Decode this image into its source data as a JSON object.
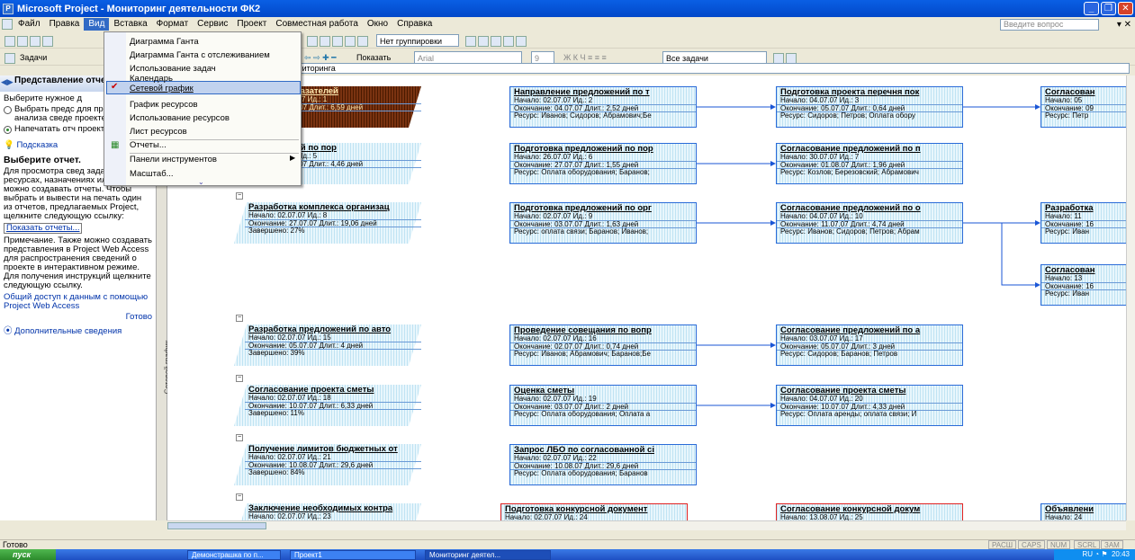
{
  "window": {
    "title": "Microsoft Project - Мониторинг деятельности ФК2"
  },
  "menubar": {
    "items": [
      "Файл",
      "Правка",
      "Вид",
      "Вставка",
      "Формат",
      "Сервис",
      "Проект",
      "Совместная работа",
      "Окно",
      "Справка"
    ],
    "ask_placeholder": "Введите вопрос"
  },
  "toolbar": {
    "grouping": "Нет группировки",
    "show_label": "Показать",
    "font": "Arial",
    "font_size": "9",
    "filter": "Все задачи",
    "tasks_label": "Задачи"
  },
  "entry_bar": {
    "value": "й для мониторинга"
  },
  "view_menu": {
    "items": [
      "Диаграмма Ганта",
      "Диаграмма Ганта с отслеживанием",
      "Использование задач",
      "Календарь",
      "Сетевой график",
      "График ресурсов",
      "Использование ресурсов",
      "Лист ресурсов",
      "Отчеты...",
      "Панели инструментов",
      "Масштаб..."
    ],
    "checked_index": 4
  },
  "side_pane": {
    "title": "Представление отчеты",
    "intro": "Выберите нужное д",
    "option1": "Выбрать предс для просмотра анализа сведе проекте",
    "option2": "Напечатать отч проекте",
    "hint_label": "Подсказка",
    "section_title": "Выберите отчет.",
    "body1": "Для просмотра свед задачах, ресурсах, назначениях или затратах можно создавать отчеты. Чтобы выбрать и вывести на печать один из отчетов, предлагаемых Project, щелкните следующую ссылку:",
    "show_reports_link": "Показать отчеты...",
    "body2": "Примечание. Также можно создавать представления в Project Web Access для распространения сведений о проекте в интерактивном режиме. Для получения инструкций щелкните следующую ссылку.",
    "share_link": "Общий доступ к данным с помощью Project Web Access",
    "done": "Готово",
    "more_info": "Дополнительные сведения"
  },
  "view_bar_label": "Сетевой график",
  "network": {
    "labels": {
      "start": "Начало:",
      "end": "Окончание:",
      "id": "Ид.:",
      "dur": "Длит.:",
      "done": "Завершено:",
      "res": "Ресурс:"
    },
    "nodes": [
      {
        "title": "перечня показателей",
        "start": "02.07.07",
        "id": "1",
        "end": "07.07",
        "dur": "6,59 дней",
        "row3": "",
        "summary": true,
        "dark": true
      },
      {
        "title": "Направление предложений по т",
        "start": "02.07.07",
        "id": "2",
        "end": "04.07.07",
        "dur": "2,52 дней",
        "row3": "Иванов; Сидоров; Абрамович;Бе"
      },
      {
        "title": "Подготовка проекта перечня пок",
        "start": "04.07.07",
        "id": "3",
        "end": "05.07.07",
        "dur": "0,64 дней",
        "row3": "Сидоров; Петров; Оплата обору"
      },
      {
        "title": "Согласован",
        "start": "05",
        "id": "",
        "end": "09",
        "dur": "",
        "row3": "Петр"
      },
      {
        "title": "предложений по пор",
        "start": "07.07",
        "id": "5",
        "end": "08.07",
        "dur": "4,46 дней",
        "row3": "",
        "summary": true
      },
      {
        "title": "Подготовка предложений по пор",
        "start": "26.07.07",
        "id": "6",
        "end": "27.07.07",
        "dur": "1,55 дней",
        "row3": "Оплата оборудования; Баранов;"
      },
      {
        "title": "Согласование предложений по п",
        "start": "30.07.07",
        "id": "7",
        "end": "01.08.07",
        "dur": "1,96 дней",
        "row3": "Козлов; Березовский; Абрамович"
      },
      {
        "title": "Разработка комплекса организац",
        "start": "02.07.07",
        "id": "8",
        "end": "27.07.07",
        "dur": "19,06 дней",
        "row3": "27%",
        "summary": true
      },
      {
        "title": "Подготовка предложений по орг",
        "start": "02.07.07",
        "id": "9",
        "end": "03.07.07",
        "dur": "1,63 дней",
        "row3": "оплата связи; Баранов; Иванов;"
      },
      {
        "title": "Согласование предложений по о",
        "start": "04.07.07",
        "id": "10",
        "end": "11.07.07",
        "dur": "4,74 дней",
        "row3": "Иванов; Сидоров; Петров; Абрам"
      },
      {
        "title": "Разработка",
        "start": "11",
        "id": "",
        "end": "16",
        "dur": "",
        "row3": "Иван"
      },
      {
        "title": "Согласован",
        "start": "13",
        "id": "",
        "end": "16",
        "dur": "",
        "row3": "Иван"
      },
      {
        "title": "Разработка предложений по авто",
        "start": "02.07.07",
        "id": "15",
        "end": "05.07.07",
        "dur": "4 дней",
        "row3": "39%",
        "summary": true
      },
      {
        "title": "Проведение совещания по вопр",
        "start": "02.07.07",
        "id": "16",
        "end": "02.07.07",
        "dur": "0,74 дней",
        "row3": "Иванов; Абрамович; Баранов;Бе"
      },
      {
        "title": "Согласование предложений по а",
        "start": "03.07.07",
        "id": "17",
        "end": "05.07.07",
        "dur": "3 дней",
        "row3": "Сидоров; Баранов; Петров"
      },
      {
        "title": "Согласование проекта сметы",
        "start": "02.07.07",
        "id": "18",
        "end": "10.07.07",
        "dur": "6,33 дней",
        "row3": "11%",
        "summary": true
      },
      {
        "title": "Оценка сметы",
        "start": "02.07.07",
        "id": "19",
        "end": "03.07.07",
        "dur": "2 дней",
        "row3": "Оплата оборудования; Оплата а"
      },
      {
        "title": "Согласование проекта сметы",
        "start": "04.07.07",
        "id": "20",
        "end": "10.07.07",
        "dur": "4,33 дней",
        "row3": "Оплата аренды; оплата связи; И"
      },
      {
        "title": "Получение лимитов бюджетных от",
        "start": "02.07.07",
        "id": "21",
        "end": "10.08.07",
        "dur": "29,6 дней",
        "row3": "84%",
        "summary": true
      },
      {
        "title": "Запрос ЛБО по согласованной сі",
        "start": "02.07.07",
        "id": "22",
        "end": "10.08.07",
        "dur": "29,6 дней",
        "row3": "Оплата оборудования; Баранов"
      },
      {
        "title": "Заключение необходимых контра",
        "start": "02.07.07",
        "id": "23",
        "end": "",
        "dur": "",
        "row3": "",
        "summary": true
      },
      {
        "title": "Подготовка конкурсной документ",
        "start": "02.07.07",
        "id": "24",
        "end": "",
        "dur": "",
        "row3": "",
        "crit": true
      },
      {
        "title": "Согласование конкурсной докум",
        "start": "13.08.07",
        "id": "25",
        "end": "",
        "dur": "",
        "row3": "",
        "crit": true
      },
      {
        "title": "Объявлени",
        "start": "24",
        "id": "",
        "end": "",
        "dur": "",
        "row3": ""
      }
    ]
  },
  "status": {
    "text": "Готово",
    "indicators": [
      "РАСШ",
      "CAPS",
      "NUM",
      "SCRL",
      "ЗАМ"
    ]
  },
  "taskbar": {
    "start": "пуск",
    "tasks": [
      "Демонстрашка по п...",
      "Проект1",
      "Мониторинг деятел..."
    ],
    "lang": "RU",
    "time": "20:43"
  },
  "colors": {
    "titlebar": "#0148c9",
    "node_border": "#2a6bd8",
    "critical": "#e02222",
    "menu_highlight": "#316ac5"
  }
}
